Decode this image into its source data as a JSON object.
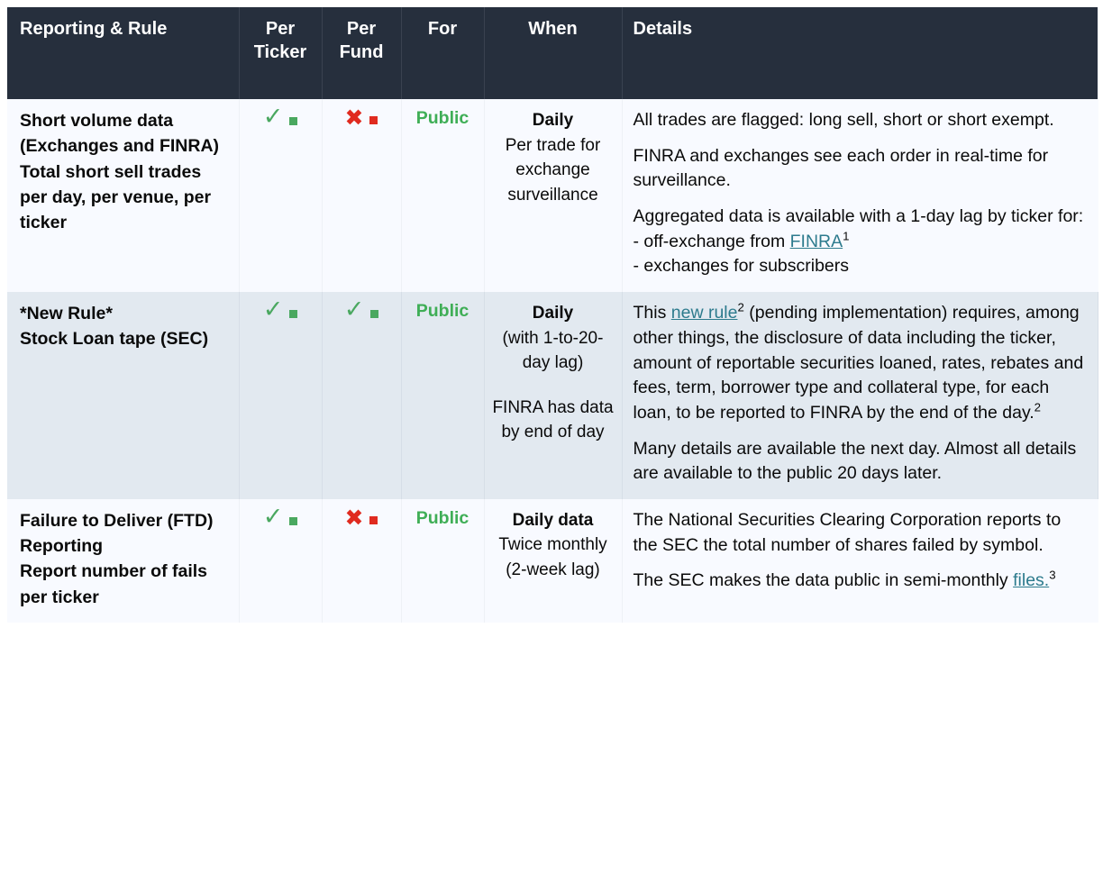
{
  "table": {
    "headers": {
      "rule": "Reporting & Rule",
      "per_ticker": "Per Ticker",
      "per_ticker_l1": "Per",
      "per_ticker_l2": "Ticker",
      "per_fund": "Per Fund",
      "per_fund_l1": "Per",
      "per_fund_l2": "Fund",
      "for": "For",
      "when": "When",
      "details": "Details"
    },
    "colors": {
      "header_bg": "#262f3d",
      "header_text": "#ffffff",
      "row_bg": "#f8faff",
      "row_alt_bg": "#e2e9f0",
      "check_green": "#4aa860",
      "x_red": "#e02b20",
      "public_green": "#3fae56",
      "link_teal": "#2d7b8d"
    },
    "rows": [
      {
        "rule": "Short volume data (Exchanges and FINRA)\nTotal short sell trades per day, per venue, per ticker",
        "rule_lines": [
          "Short volume data (Exchanges and FINRA)",
          "Total short sell trades per day, per venue, per ticker"
        ],
        "per_ticker": "check",
        "per_ticker_icon": "check-mark-icon",
        "per_fund": "cross",
        "per_fund_icon": "cross-mark-icon",
        "for": "Public",
        "when_first": "Daily",
        "when_rest": "Per trade for exchange surveillance",
        "details": [
          "All trades are flagged: long sell, short or short exempt.",
          "FINRA and exchanges see each order in real-time for surveillance.",
          "Aggregated data is available with a 1-day lag by ticker for:",
          "- off-exchange from FINRA",
          "- exchanges for subscribers"
        ],
        "detail_link_text": "FINRA",
        "detail_link_footnote": "1",
        "detail_prefix": "- off-exchange from ",
        "detail_last": "- exchanges for subscribers"
      },
      {
        "rule_lines": [
          "*New Rule*",
          "Stock Loan tape (SEC)"
        ],
        "rule_line1": "*New Rule*",
        "rule_line2": "Stock Loan tape (SEC)",
        "per_ticker": "check",
        "per_ticker_icon": "check-mark-icon",
        "per_fund": "check",
        "per_fund_icon": "check-mark-icon",
        "for": "Public",
        "when_first": "Daily",
        "when_rest": "(with 1-to-20-day lag)",
        "when_extra": "FINRA has data by end of day",
        "details_p1_a": "This ",
        "details_p1_link": "new rule",
        "details_p1_fn": "2",
        "details_p1_b": " (pending implementation) requires, among other things, the disclosure of data including the ticker, amount of reportable securities loaned, rates, rebates and fees, term, borrower type and collateral type, for each loan, to be reported to FINRA by the end of the day.",
        "details_p1_fn2": "2",
        "details_p2": "Many details are available the next day. Almost all details are available to the public 20 days later."
      },
      {
        "rule_lines": [
          "Failure to Deliver (FTD) Reporting",
          "Report number of fails per ticker"
        ],
        "rule_line1": "Failure to Deliver (FTD) Reporting",
        "rule_line2": "Report number of fails per ticker",
        "per_ticker": "check",
        "per_ticker_icon": "check-mark-icon",
        "per_fund": "cross",
        "per_fund_icon": "cross-mark-icon",
        "for": "Public",
        "when_first": "Daily data",
        "when_rest": "Twice monthly (2-week lag)",
        "details_p1": "The National Securities Clearing Corporation reports to the SEC the total number of shares failed by symbol.",
        "details_p2_a": "The SEC makes the data public in semi-monthly ",
        "details_p2_link": "files.",
        "details_p2_fn": "3"
      }
    ]
  }
}
